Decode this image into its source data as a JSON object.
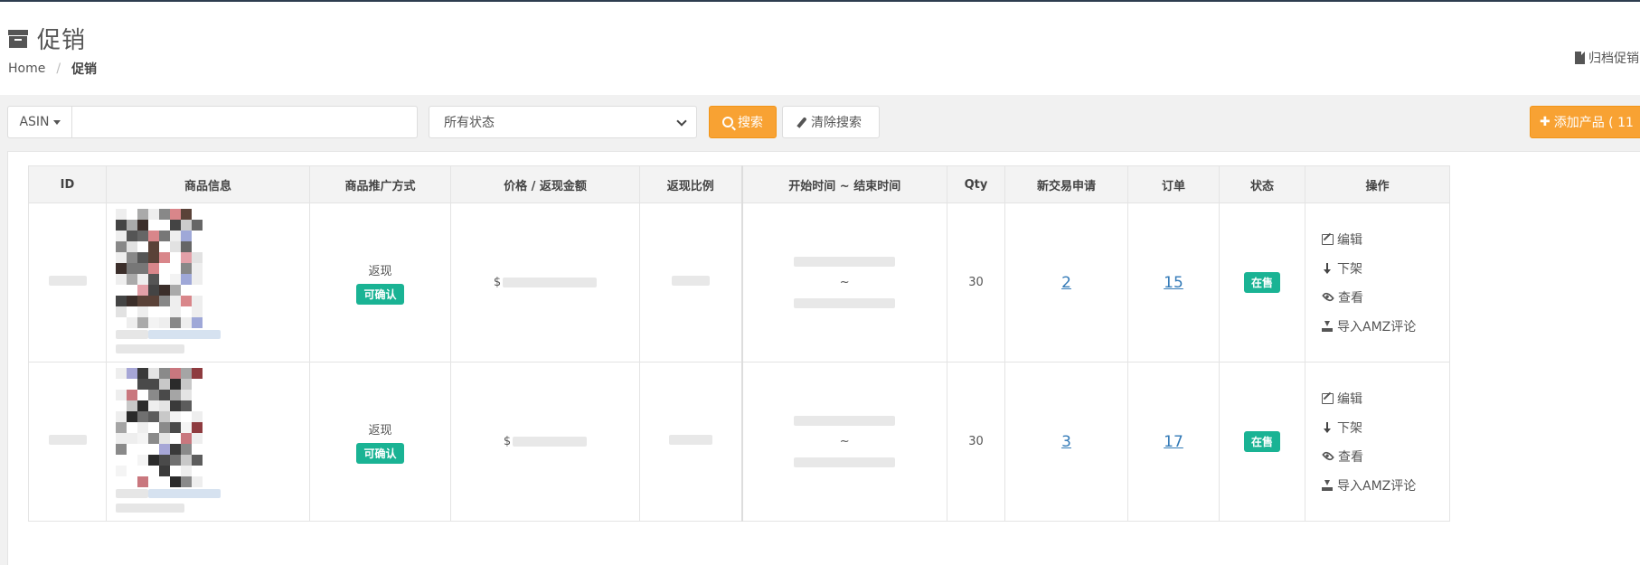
{
  "header": {
    "title": "促销",
    "breadcrumb": {
      "home": "Home",
      "current": "促销"
    },
    "archive_link": "归档促销"
  },
  "toolbar": {
    "search_type": "ASIN",
    "search_placeholder": "",
    "status_select": "所有状态",
    "search_button": "搜索",
    "clear_button": "清除搜索",
    "add_button": "添加产品 ( 11"
  },
  "table": {
    "columns": [
      "ID",
      "商品信息",
      "商品推广方式",
      "价格 / 返现金额",
      "返现比例",
      "开始时间 ~ 结束时间",
      "Qty",
      "新交易申请",
      "订单",
      "状态",
      "操作"
    ],
    "rows": [
      {
        "promo_type": "返现",
        "confirm_badge": "可确认",
        "price_prefix": "$",
        "date_sep": "~",
        "qty": "30",
        "new_requests": "2",
        "orders": "15",
        "status": "在售"
      },
      {
        "promo_type": "返现",
        "confirm_badge": "可确认",
        "price_prefix": "$",
        "date_sep": "~",
        "qty": "30",
        "new_requests": "3",
        "orders": "17",
        "status": "在售"
      }
    ],
    "actions": {
      "edit": "编辑",
      "unlist": "下架",
      "view": "查看",
      "import": "导入AMZ评论"
    }
  },
  "colors": {
    "accent_orange": "#f8a233",
    "success_green": "#1ab394",
    "link_blue": "#337ab7"
  }
}
